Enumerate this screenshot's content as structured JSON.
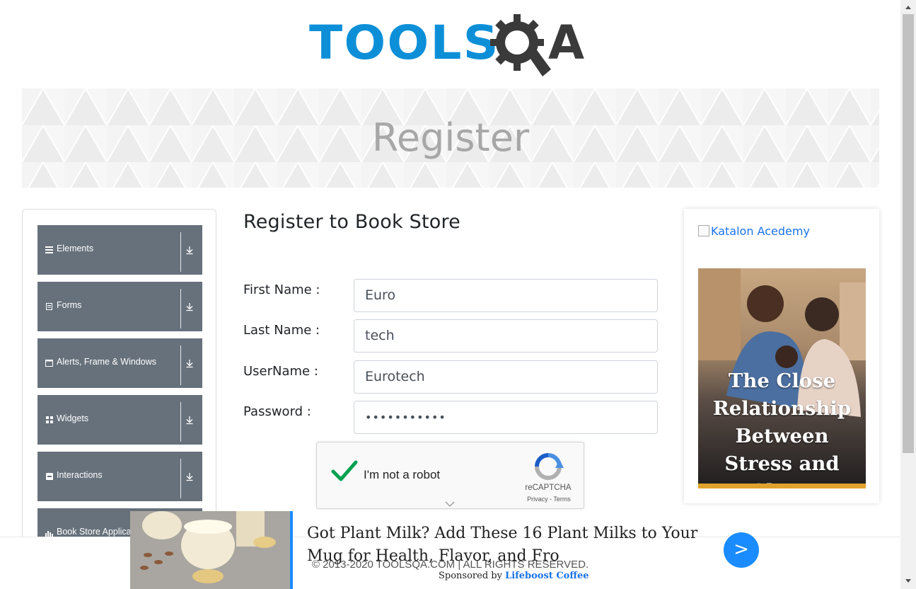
{
  "header": {
    "logo_tools": "TOOLS",
    "logo_a": "A"
  },
  "banner": {
    "title": "Register"
  },
  "sidebar": {
    "items": [
      {
        "label": "Elements",
        "icon": "hamburger-icon"
      },
      {
        "label": "Forms",
        "icon": "form-icon"
      },
      {
        "label": "Alerts, Frame & Windows",
        "icon": "window-icon"
      },
      {
        "label": "Widgets",
        "icon": "widgets-icon"
      },
      {
        "label": "Interactions",
        "icon": "interactions-icon"
      },
      {
        "label": "Book Store Applica",
        "icon": "chart-icon"
      }
    ]
  },
  "form": {
    "title": "Register to Book Store",
    "first_name_label": "First Name :",
    "first_name_value": "Euro",
    "last_name_label": "Last Name :",
    "last_name_value": "tech",
    "username_label": "UserName :",
    "username_value": "Eurotech",
    "password_label": "Password :",
    "password_value": "•••••••••••"
  },
  "captcha": {
    "label": "I'm not a robot",
    "brand": "reCAPTCHA",
    "terms": "Privacy - Terms"
  },
  "right_ad": {
    "alt_text": "Katalon Acedemy",
    "headline": "The Close Relationship Between Stress and Sleep"
  },
  "footer": {
    "copyright": "© 2013-2020 TOOLSQA.COM | ALL RIGHTS RESERVED."
  },
  "bottom_ad": {
    "headline": "Got Plant Milk? Add These 16 Plant Milks to Your Mug for Health, Flavor, and Fro",
    "sponsor_prefix": "Sponsored by",
    "sponsor_name": "Lifeboost Coffee",
    "button": ">"
  },
  "colors": {
    "brand_blue": "#0d8fd8",
    "sidebar_bg": "#67717c",
    "link_blue": "#1a73e8",
    "button_blue": "#1a8cff"
  }
}
